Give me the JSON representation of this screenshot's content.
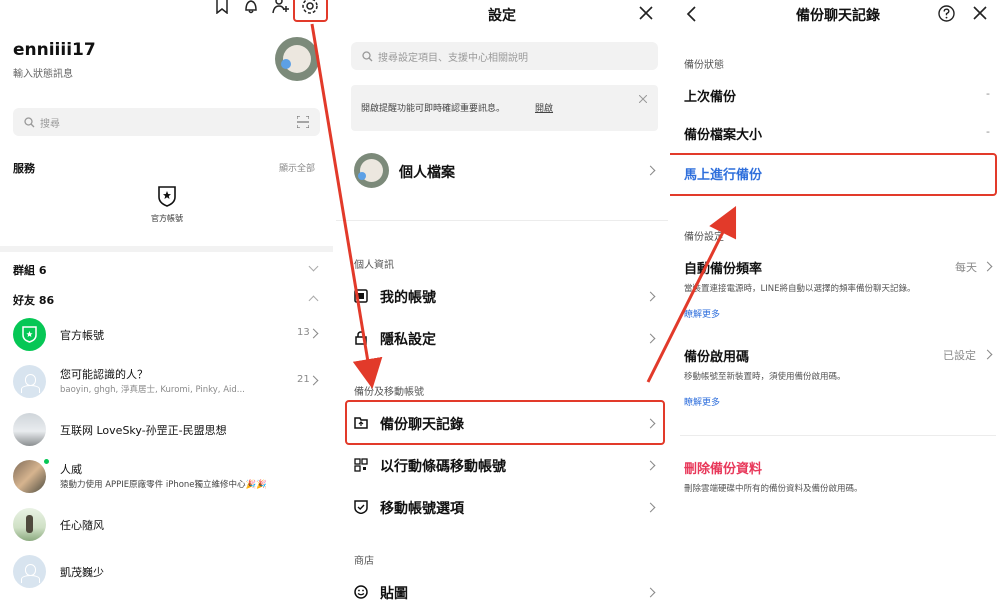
{
  "colors": {
    "accent_red": "#e23a2a",
    "line_green": "#06c755",
    "link_blue": "#2f6fdc",
    "delete_red": "#e8385a"
  },
  "home": {
    "username": "enniiii17",
    "status_msg": "輸入狀態訊息",
    "search_placeholder": "搜尋",
    "services_label": "服務",
    "show_all": "顯示全部",
    "official_account_service": "官方帳號",
    "groups_label": "群組 6",
    "friends_label": "好友 86",
    "friends": [
      {
        "name": "官方帳號",
        "count": "13"
      },
      {
        "name": "您可能認識的人？",
        "sub": "baoyin, ghgh, 淨真居士, Kuromi, Pinky, Aid...",
        "count": "21"
      },
      {
        "name": "互联网 LoveSky-孙罡正-民盟思想"
      },
      {
        "name": "人威",
        "sub": "猿動力使用 APPIE原廠零件 iPhone獨立維修中心🎉🎉"
      },
      {
        "name": "任心隨风"
      },
      {
        "name": "凱茂巍少"
      }
    ]
  },
  "settings": {
    "title": "設定",
    "search_placeholder": "搜尋設定項目、支援中心相關說明",
    "notice_text": "開啟提醒功能可即時確認重要訊息。",
    "notice_link": "開啟",
    "profile_label": "個人檔案",
    "section_personal": "個人資訊",
    "my_account": "我的帳號",
    "privacy": "隱私設定",
    "section_backup": "備份及移動帳號",
    "backup_chats": "備份聊天記錄",
    "qr_transfer": "以行動條碼移動帳號",
    "transfer_options": "移動帳號選項",
    "section_shop": "商店",
    "stickers": "貼圖"
  },
  "backup": {
    "title": "備份聊天記錄",
    "section_status": "備份狀態",
    "last_backup": "上次備份",
    "last_backup_value": "-",
    "file_size": "備份檔案大小",
    "file_size_value": "-",
    "backup_now": "馬上進行備份",
    "section_settings": "備份設定",
    "auto_freq": "自動備份頻率",
    "auto_freq_value": "每天",
    "auto_freq_desc": "當裝置連接電源時，LINE將自動以選擇的頻率備份聊天記錄。",
    "learn_more": "瞭解更多",
    "pin": "備份啟用碼",
    "pin_value": "已設定",
    "pin_desc": "移動帳號至新裝置時，須使用備份啟用碼。",
    "learn_more_2": "瞭解更多",
    "delete": "刪除備份資料",
    "delete_desc": "刪除雲端硬碟中所有的備份資料及備份啟用碼。"
  }
}
